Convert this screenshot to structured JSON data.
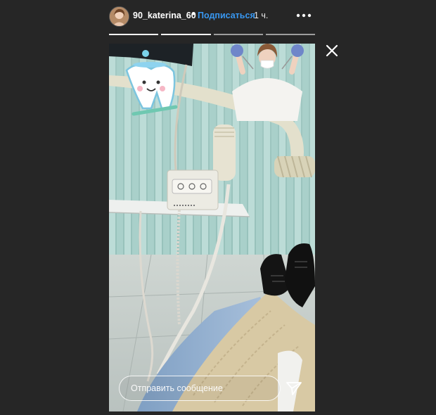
{
  "header": {
    "username": "90_katerina_60",
    "separator": "•",
    "follow_label": "Подписаться",
    "time_ago": "1 ч."
  },
  "progress": {
    "segments": 4,
    "current": 2
  },
  "reply": {
    "placeholder": "Отправить сообщение"
  },
  "icons": {
    "more": "more-horizontal-icon",
    "close": "close-icon",
    "send": "send-icon"
  },
  "colors": {
    "background": "#262626",
    "link": "#3897f0",
    "text": "#ffffff"
  }
}
